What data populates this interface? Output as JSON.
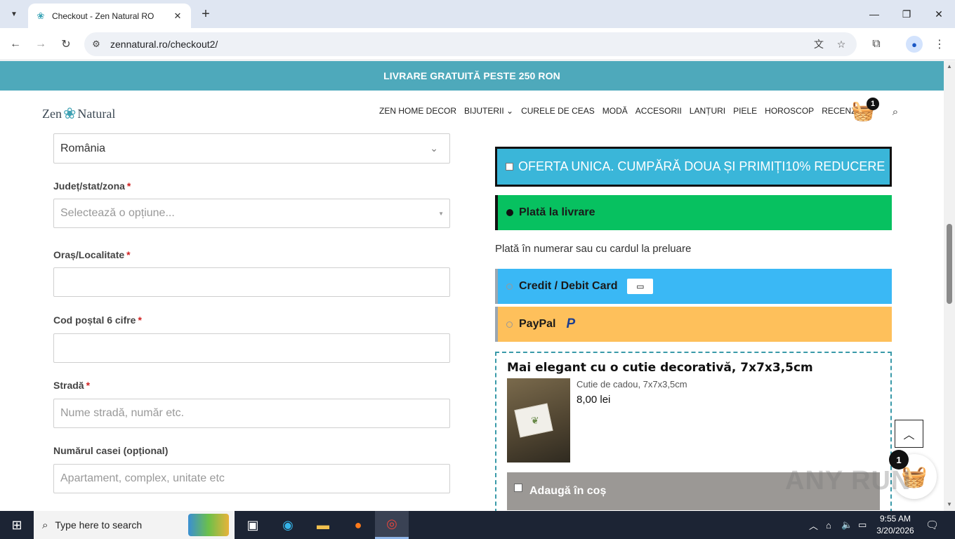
{
  "browser": {
    "tab_title": "Checkout - Zen Natural RO",
    "url": "zennatural.ro/checkout2/",
    "new_tab": "+",
    "close_tab": "✕"
  },
  "site": {
    "announcement": "LIVRARE GRATUITĂ PESTE 250 RON",
    "logo_left": "Zen",
    "logo_right": "Natural",
    "menu": [
      "ZEN HOME DECOR",
      "BIJUTERII ⌄",
      "CURELE DE CEAS",
      "MODĂ",
      "ACCESORII",
      "LANȚURI",
      "PIELE",
      "HOROSCOP",
      "RECENZIILE"
    ],
    "cart_count": "1"
  },
  "form": {
    "country_value": "România",
    "county_label": "Județ/stat/zona",
    "county_placeholder": "Selectează o opțiune...",
    "city_label": "Oraș/Localitate",
    "zip_label": "Cod poștal 6 cifre",
    "street_label": "Stradă",
    "street_placeholder": "Nume stradă, număr etc.",
    "house_label": "Numărul casei (opțional)",
    "house_placeholder": "Apartament, complex, unitate etc",
    "required_mark": "*"
  },
  "checkout": {
    "offer_text": "OFERTA UNICA. CUMPĂRĂ DOUA ȘI PRIMIȚI10% REDUCERE",
    "cod_label": "Plată la livrare",
    "cod_description": "Plată în numerar sau cu cardul la preluare",
    "card_label": "Credit / Debit Card",
    "paypal_label": "PayPal",
    "paypal_logo": "P",
    "upsell": {
      "title": "Mai elegant cu o cutie decorativă, 7x7x3,5cm",
      "subtitle": "Cutie de cadou, 7x7x3,5cm",
      "price": "8,00 lei",
      "add_label": "Adaugă în coș"
    },
    "floating_cart_count": "1"
  },
  "watermark": "ANY RUN",
  "taskbar": {
    "search_placeholder": "Type here to search",
    "time": "9:55 AM",
    "date": "3/20/2026"
  },
  "colors": {
    "announcement_bg": "#4ea9bb",
    "offer_bg": "#3ab6d9",
    "cod_bg": "#07c160",
    "card_bg": "#3ab8f5",
    "paypal_bg": "#fec05b",
    "upsell_border": "#3a9aa9"
  }
}
